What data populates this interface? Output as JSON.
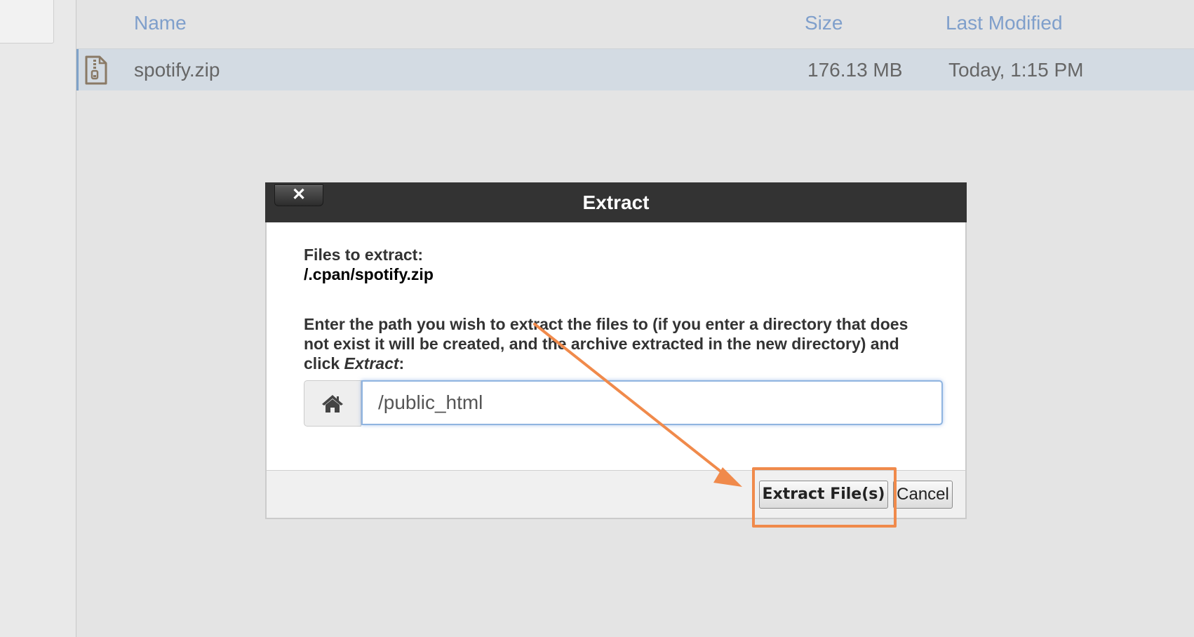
{
  "file_list": {
    "headers": {
      "name": "Name",
      "size": "Size",
      "modified": "Last Modified"
    },
    "rows": [
      {
        "icon": "zip-file-icon",
        "name": "spotify.zip",
        "size": "176.13 MB",
        "modified": "Today, 1:15 PM"
      }
    ]
  },
  "dialog": {
    "title": "Extract",
    "close_label": "✕",
    "files_label": "Files to extract:",
    "files_path": "/.cpan/spotify.zip",
    "instructions_before": "Enter the path you wish to extract the files to (if you enter a directory that does not exist it will be created, and the archive extracted in the new directory) and click ",
    "instructions_em": "Extract",
    "instructions_after": ":",
    "path_value": "/public_html",
    "extract_button": "Extract File(s)",
    "cancel_button": "Cancel"
  },
  "colors": {
    "annotation": "#f08a4b",
    "header_text": "#7f9fcb",
    "dialog_titlebar": "#333333"
  }
}
